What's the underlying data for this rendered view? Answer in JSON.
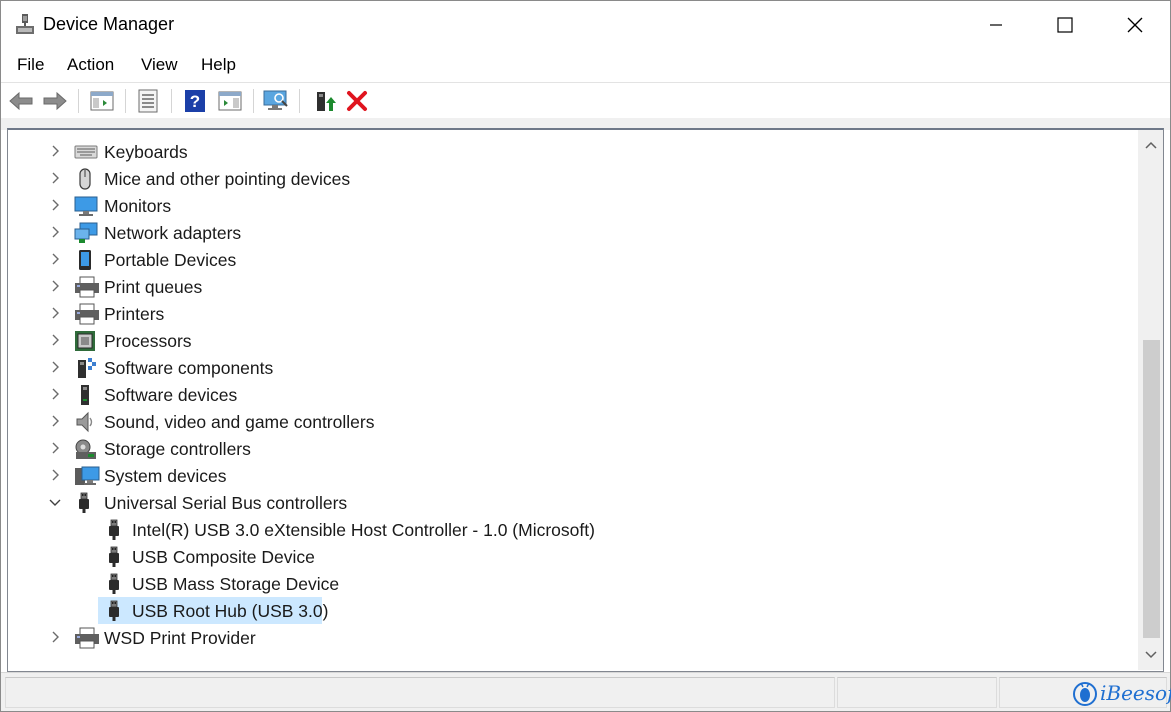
{
  "window": {
    "title": "Device Manager"
  },
  "menu": [
    "File",
    "Action",
    "View",
    "Help"
  ],
  "toolbar": {
    "buttons": [
      "back-icon",
      "forward-icon",
      "show-hide-console-tree-icon",
      "properties-icon",
      "help-icon",
      "action-pane-icon",
      "scan-hardware-icon",
      "update-driver-icon",
      "uninstall-device-icon"
    ],
    "colors": {
      "help": "#1b3fa8",
      "uninstall": "#e0141e",
      "update": "#1c8a2e"
    }
  },
  "tree": {
    "rows": [
      {
        "label": "Keyboards",
        "icon": "keyboard-icon",
        "expanded": false
      },
      {
        "label": "Mice and other pointing devices",
        "icon": "mouse-icon",
        "expanded": false
      },
      {
        "label": "Monitors",
        "icon": "monitor-icon",
        "expanded": false
      },
      {
        "label": "Network adapters",
        "icon": "network-adapter-icon",
        "expanded": false
      },
      {
        "label": "Portable Devices",
        "icon": "portable-device-icon",
        "expanded": false
      },
      {
        "label": "Print queues",
        "icon": "printer-icon",
        "expanded": false
      },
      {
        "label": "Printers",
        "icon": "printer-icon",
        "expanded": false
      },
      {
        "label": "Processors",
        "icon": "processor-icon",
        "expanded": false
      },
      {
        "label": "Software components",
        "icon": "software-component-icon",
        "expanded": false
      },
      {
        "label": "Software devices",
        "icon": "software-device-icon",
        "expanded": false
      },
      {
        "label": "Sound, video and game controllers",
        "icon": "speaker-icon",
        "expanded": false
      },
      {
        "label": "Storage controllers",
        "icon": "storage-controller-icon",
        "expanded": false
      },
      {
        "label": "System devices",
        "icon": "system-device-icon",
        "expanded": false
      },
      {
        "label": "Universal Serial Bus controllers",
        "icon": "usb-icon",
        "expanded": true
      },
      {
        "label": "Intel(R) USB 3.0 eXtensible Host Controller - 1.0 (Microsoft)",
        "icon": "usb-icon",
        "child": true
      },
      {
        "label": "USB Composite Device",
        "icon": "usb-icon",
        "child": true
      },
      {
        "label": "USB Mass Storage Device",
        "icon": "usb-icon",
        "child": true
      },
      {
        "label": "USB Root Hub (USB 3.0)",
        "icon": "usb-icon",
        "child": true,
        "selected": true
      },
      {
        "label": "WSD Print Provider",
        "icon": "printer-icon",
        "expanded": false
      }
    ],
    "selection_color": "#cce8ff"
  },
  "watermark": {
    "text": "iBeesoft"
  }
}
